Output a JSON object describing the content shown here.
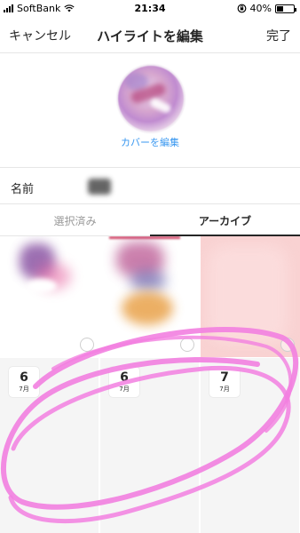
{
  "status_bar": {
    "carrier": "SoftBank",
    "time": "21:34",
    "battery": "40%",
    "battery_level": 0.4
  },
  "nav": {
    "cancel_label": "キャンセル",
    "title": "ハイライトを編集",
    "done_label": "完了"
  },
  "cover": {
    "edit_label": "カバーを編集"
  },
  "name_field": {
    "label": "名前",
    "value": ""
  },
  "tabs": [
    {
      "label": "選択済み"
    },
    {
      "label": "アーカイブ"
    }
  ],
  "archive_items": [
    {
      "day": "6",
      "month": "7月"
    },
    {
      "day": "6",
      "month": "7月"
    },
    {
      "day": "7",
      "month": "7月"
    }
  ],
  "colors": {
    "accent_blue": "#3897f0",
    "text": "#262626",
    "muted": "#999999",
    "annotation_pink": "#f27fe0"
  }
}
